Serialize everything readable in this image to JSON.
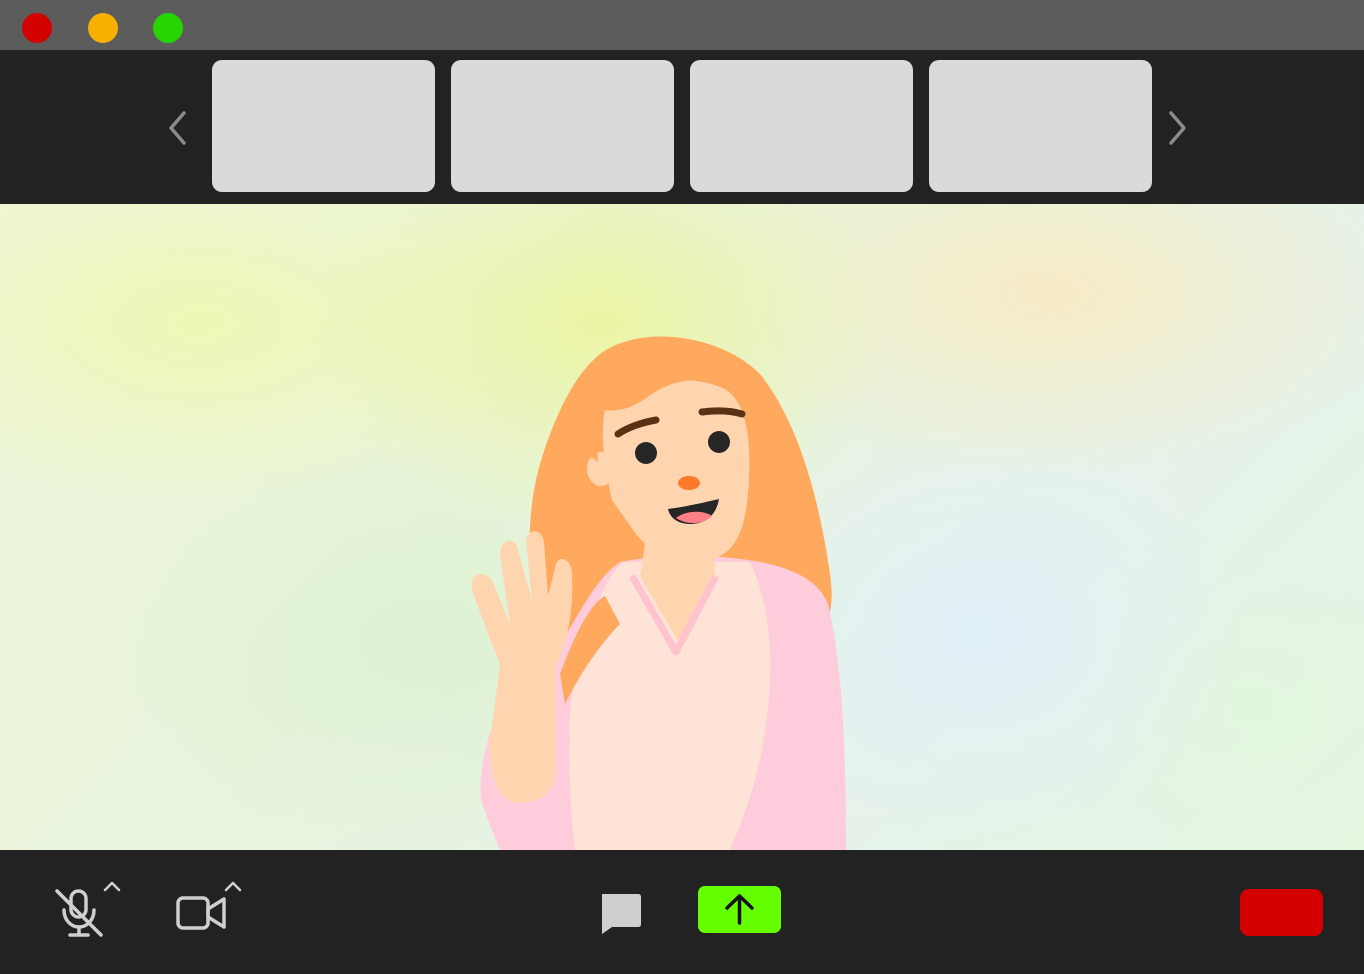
{
  "window": {
    "traffic_lights": {
      "close_color": "#d40000",
      "minimize_color": "#f5b000",
      "zoom_color": "#26d400"
    }
  },
  "participants_strip": {
    "prev_icon": "chevron-left-icon",
    "next_icon": "chevron-right-icon",
    "thumbnail_count_visible": 4
  },
  "video": {
    "subject": "cartoon-woman-waving"
  },
  "toolbar": {
    "mic": {
      "icon": "microphone-muted-icon",
      "state": "muted",
      "options_icon": "caret-up-icon"
    },
    "camera": {
      "icon": "video-camera-icon",
      "state": "on",
      "options_icon": "caret-up-icon"
    },
    "chat": {
      "icon": "chat-bubble-icon"
    },
    "share": {
      "icon": "arrow-up-icon",
      "color": "#66ff00"
    },
    "leave": {
      "color": "#d40000"
    }
  }
}
